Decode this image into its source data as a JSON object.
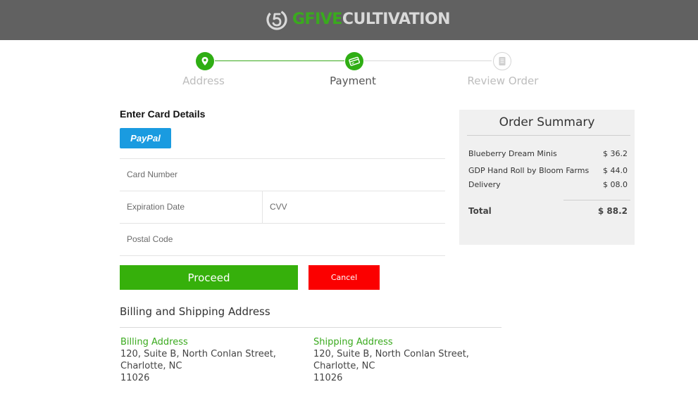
{
  "header": {
    "brand_part1": "GFIVE",
    "brand_part2": "CULTIVATION",
    "brand_green": "#3aaa1e"
  },
  "stepper": {
    "steps": [
      {
        "label": "Address",
        "state": "complete",
        "icon": "map-pin-icon"
      },
      {
        "label": "Payment",
        "state": "active",
        "icon": "credit-card-icon"
      },
      {
        "label": "Review Order",
        "state": "pending",
        "icon": "document-icon"
      }
    ]
  },
  "card": {
    "title": "Enter Card Details",
    "paypal_label": "PayPal",
    "card_number_placeholder": "Card Number",
    "expiration_placeholder": "Expiration Date",
    "cvv_placeholder": "CVV",
    "postal_placeholder": "Postal Code",
    "proceed_label": "Proceed",
    "cancel_label": "Cancel"
  },
  "billing_shipping": {
    "title": "Billing and Shipping Address",
    "billing": {
      "heading": "Billing Address",
      "line1": "120, Suite B, North Conlan Street,",
      "line2": "Charlotte, NC",
      "line3": "11026"
    },
    "shipping": {
      "heading": "Shipping Address",
      "line1": "120, Suite B, North Conlan Street,",
      "line2": "Charlotte, NC",
      "line3": "11026"
    }
  },
  "summary": {
    "title": "Order Summary",
    "items": [
      {
        "name": "Blueberry Dream Minis",
        "price": "$ 36.2"
      },
      {
        "name": "GDP Hand Roll by Bloom Farms",
        "price": "$ 44.0"
      },
      {
        "name": "Delivery",
        "price": "$ 08.0"
      }
    ],
    "total_label": "Total",
    "total_value": "$ 88.2"
  },
  "colors": {
    "accent_green": "#36b00b",
    "cancel_red": "#fb0000",
    "paypal_blue": "#1a9be0",
    "header_grey": "#616161"
  }
}
